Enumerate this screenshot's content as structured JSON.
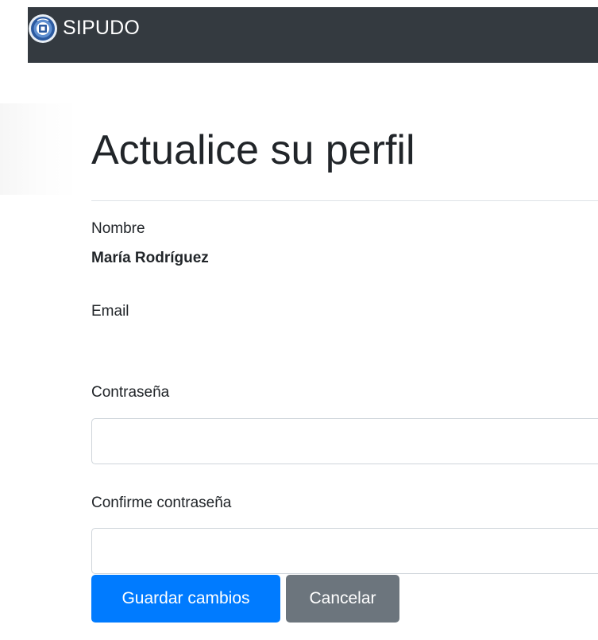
{
  "navbar": {
    "brand": "SIPUDO",
    "brand_logo_icon": "university-seal-icon",
    "background": "#343a40"
  },
  "profile": {
    "title": "Actualice su perfil",
    "name_label": "Nombre",
    "name_value": "María Rodríguez",
    "email_label": "Email",
    "email_value": "",
    "password_label": "Contraseña",
    "password_value": "",
    "confirm_label": "Confirme contraseña",
    "confirm_value": ""
  },
  "actions": {
    "save_label": "Guardar cambios",
    "cancel_label": "Cancelar"
  },
  "colors": {
    "primary": "#007bff",
    "secondary": "#6c757d",
    "text": "#212529",
    "border": "#ced4da"
  }
}
